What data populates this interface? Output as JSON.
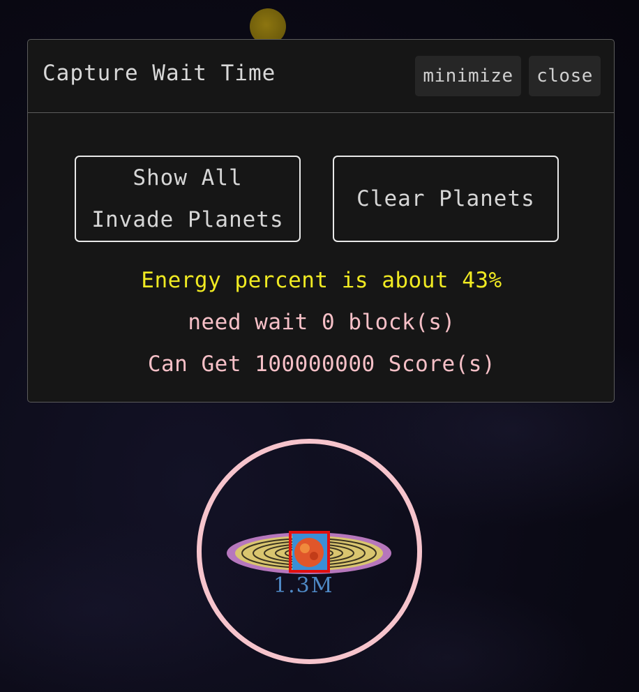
{
  "dialog": {
    "title": "Capture Wait Time",
    "minimize_label": "minimize",
    "close_label": "close"
  },
  "actions": {
    "show_all_line1": "Show All",
    "show_all_line2": "Invade Planets",
    "clear_label": "Clear Planets"
  },
  "info": {
    "energy_text": "Energy percent is about 43%",
    "wait_text": "need wait 0 block(s)",
    "score_text": "Can Get 100000000 Score(s)"
  },
  "planet": {
    "label": "1.3M",
    "ring_color": "#f6c4cc",
    "selection_color": "#e01010"
  },
  "colors": {
    "energy_text": "#f0ea22",
    "info_text": "#f6c0c7",
    "panel_bg": "#161616"
  }
}
